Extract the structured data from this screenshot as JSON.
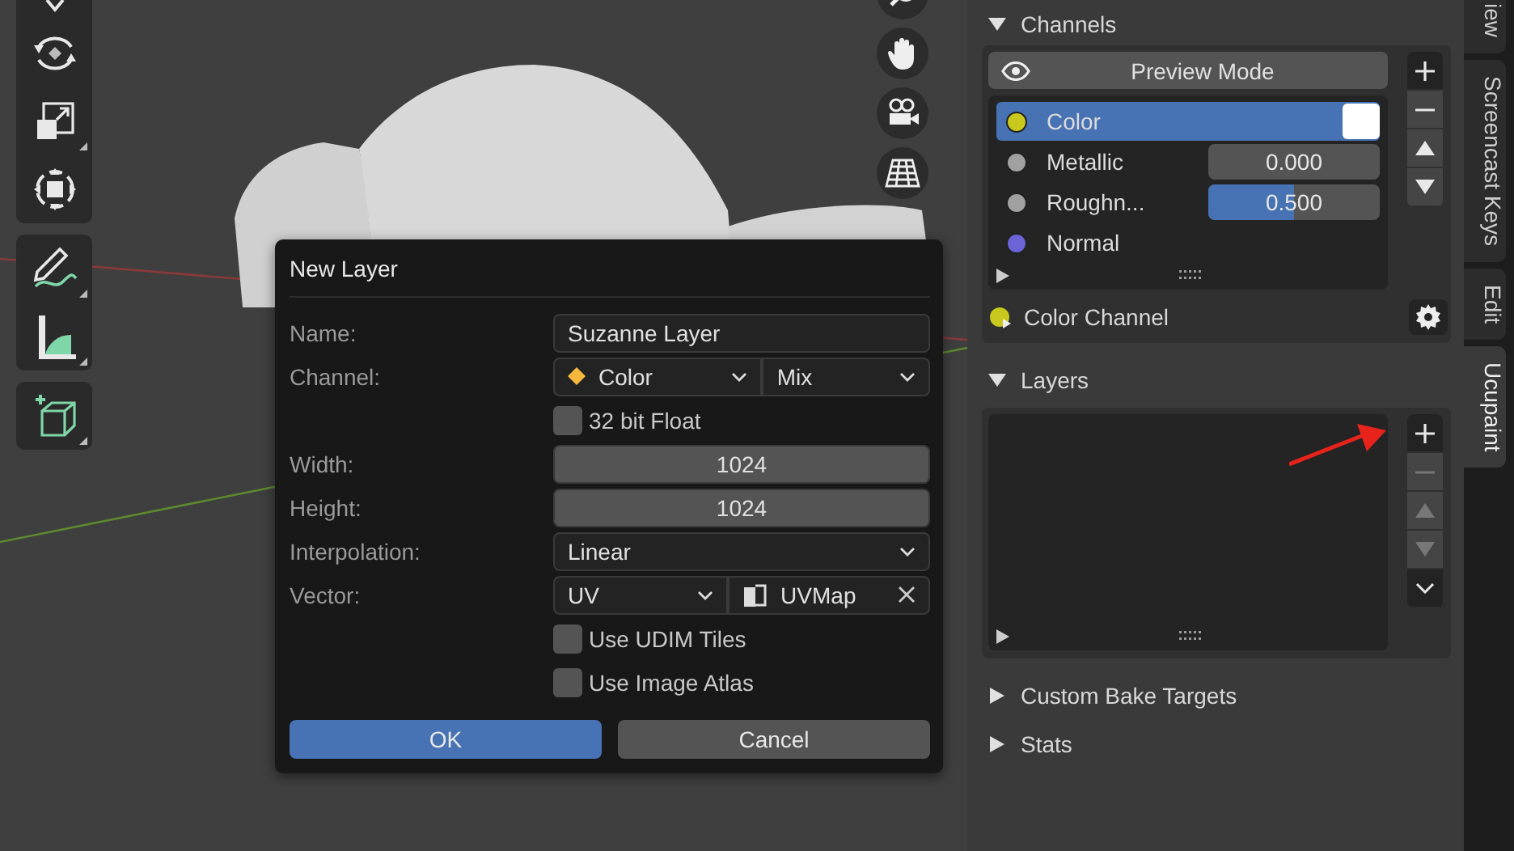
{
  "dialog": {
    "title": "New Layer",
    "name": {
      "label": "Name:",
      "value": "Suzanne Layer"
    },
    "channel": {
      "label": "Channel:",
      "value": "Color",
      "blend": "Mix"
    },
    "float32": {
      "label": "32 bit Float",
      "checked": false
    },
    "width": {
      "label": "Width:",
      "value": "1024"
    },
    "height": {
      "label": "Height:",
      "value": "1024"
    },
    "interpolation": {
      "label": "Interpolation:",
      "value": "Linear"
    },
    "vector": {
      "label": "Vector:",
      "value": "UV",
      "uv_map": "UVMap"
    },
    "options": [
      {
        "label": "Use UDIM Tiles",
        "checked": false
      },
      {
        "label": "Use Image Atlas",
        "checked": false
      }
    ],
    "ok": "OK",
    "cancel": "Cancel"
  },
  "channels": {
    "title": "Channels",
    "expanded": true,
    "preview_button": "Preview Mode",
    "items": [
      {
        "name": "Color",
        "color": "#c8c81e",
        "selected": true,
        "kind": "swatch"
      },
      {
        "name": "Metallic",
        "color": "#a0a0a0",
        "selected": false,
        "kind": "slider",
        "value": "0.000",
        "level": 0
      },
      {
        "name": "Roughn...",
        "color": "#a0a0a0",
        "selected": false,
        "kind": "slider",
        "value": "0.500",
        "level": 0.5
      },
      {
        "name": "Normal",
        "color": "#6b63d6",
        "selected": false,
        "kind": "none"
      }
    ],
    "buttons": [
      {
        "kind": "add",
        "disabled": false
      },
      {
        "kind": "remove",
        "disabled": false
      },
      {
        "kind": "up",
        "disabled": false
      },
      {
        "kind": "down",
        "disabled": false
      }
    ],
    "active_channel": "Color Channel"
  },
  "layers": {
    "title": "Layers",
    "expanded": true,
    "buttons": [
      {
        "kind": "add",
        "disabled": false
      },
      {
        "kind": "remove",
        "disabled": true
      },
      {
        "kind": "up",
        "disabled": true
      },
      {
        "kind": "down",
        "disabled": true
      },
      {
        "kind": "menu",
        "disabled": false
      }
    ]
  },
  "sections": [
    {
      "title": "Custom Bake Targets",
      "expanded": false
    },
    {
      "title": "Stats",
      "expanded": false
    }
  ],
  "tabs": [
    {
      "label": "iew",
      "selected": false
    },
    {
      "label": "Screencast Keys",
      "selected": false
    },
    {
      "label": "Edit",
      "selected": false
    },
    {
      "label": "Ucupaint",
      "selected": true
    }
  ]
}
